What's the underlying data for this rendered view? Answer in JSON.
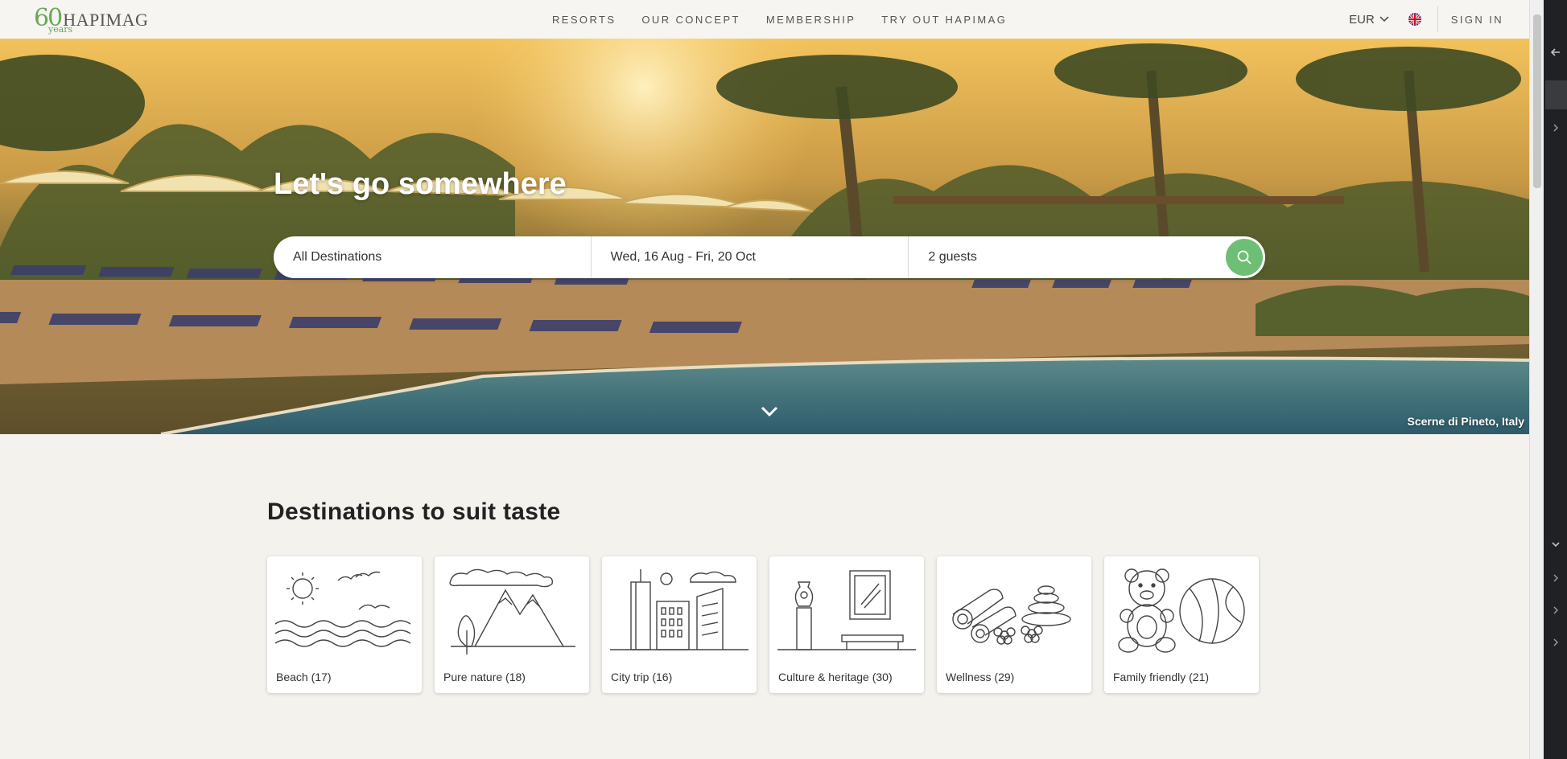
{
  "header": {
    "logo": {
      "sixty": "60",
      "years": "years",
      "brand": "HAPIMAG"
    },
    "nav": [
      "RESORTS",
      "OUR CONCEPT",
      "MEMBERSHIP",
      "TRY OUT HAPIMAG"
    ],
    "currency": "EUR",
    "language_icon": "uk-flag-icon",
    "sign_in": "SIGN IN"
  },
  "hero": {
    "title": "Let's go somewhere",
    "search": {
      "destination": "All Destinations",
      "dates": "Wed, 16 Aug - Fri, 20 Oct",
      "guests": "2 guests"
    },
    "caption": "Scerne di Pineto, Italy"
  },
  "destinations": {
    "title": "Destinations to suit taste",
    "cards": [
      {
        "label": "Beach (17)",
        "icon": "beach-icon"
      },
      {
        "label": "Pure nature (18)",
        "icon": "mountain-icon"
      },
      {
        "label": "City trip (16)",
        "icon": "city-icon"
      },
      {
        "label": "Culture & heritage (30)",
        "icon": "culture-icon"
      },
      {
        "label": "Wellness (29)",
        "icon": "wellness-icon"
      },
      {
        "label": "Family friendly (21)",
        "icon": "teddy-bear-icon"
      }
    ]
  },
  "colors": {
    "accent_green": "#6cbf75",
    "logo_green": "#6aa857",
    "page_bg": "#f4f2ec"
  }
}
